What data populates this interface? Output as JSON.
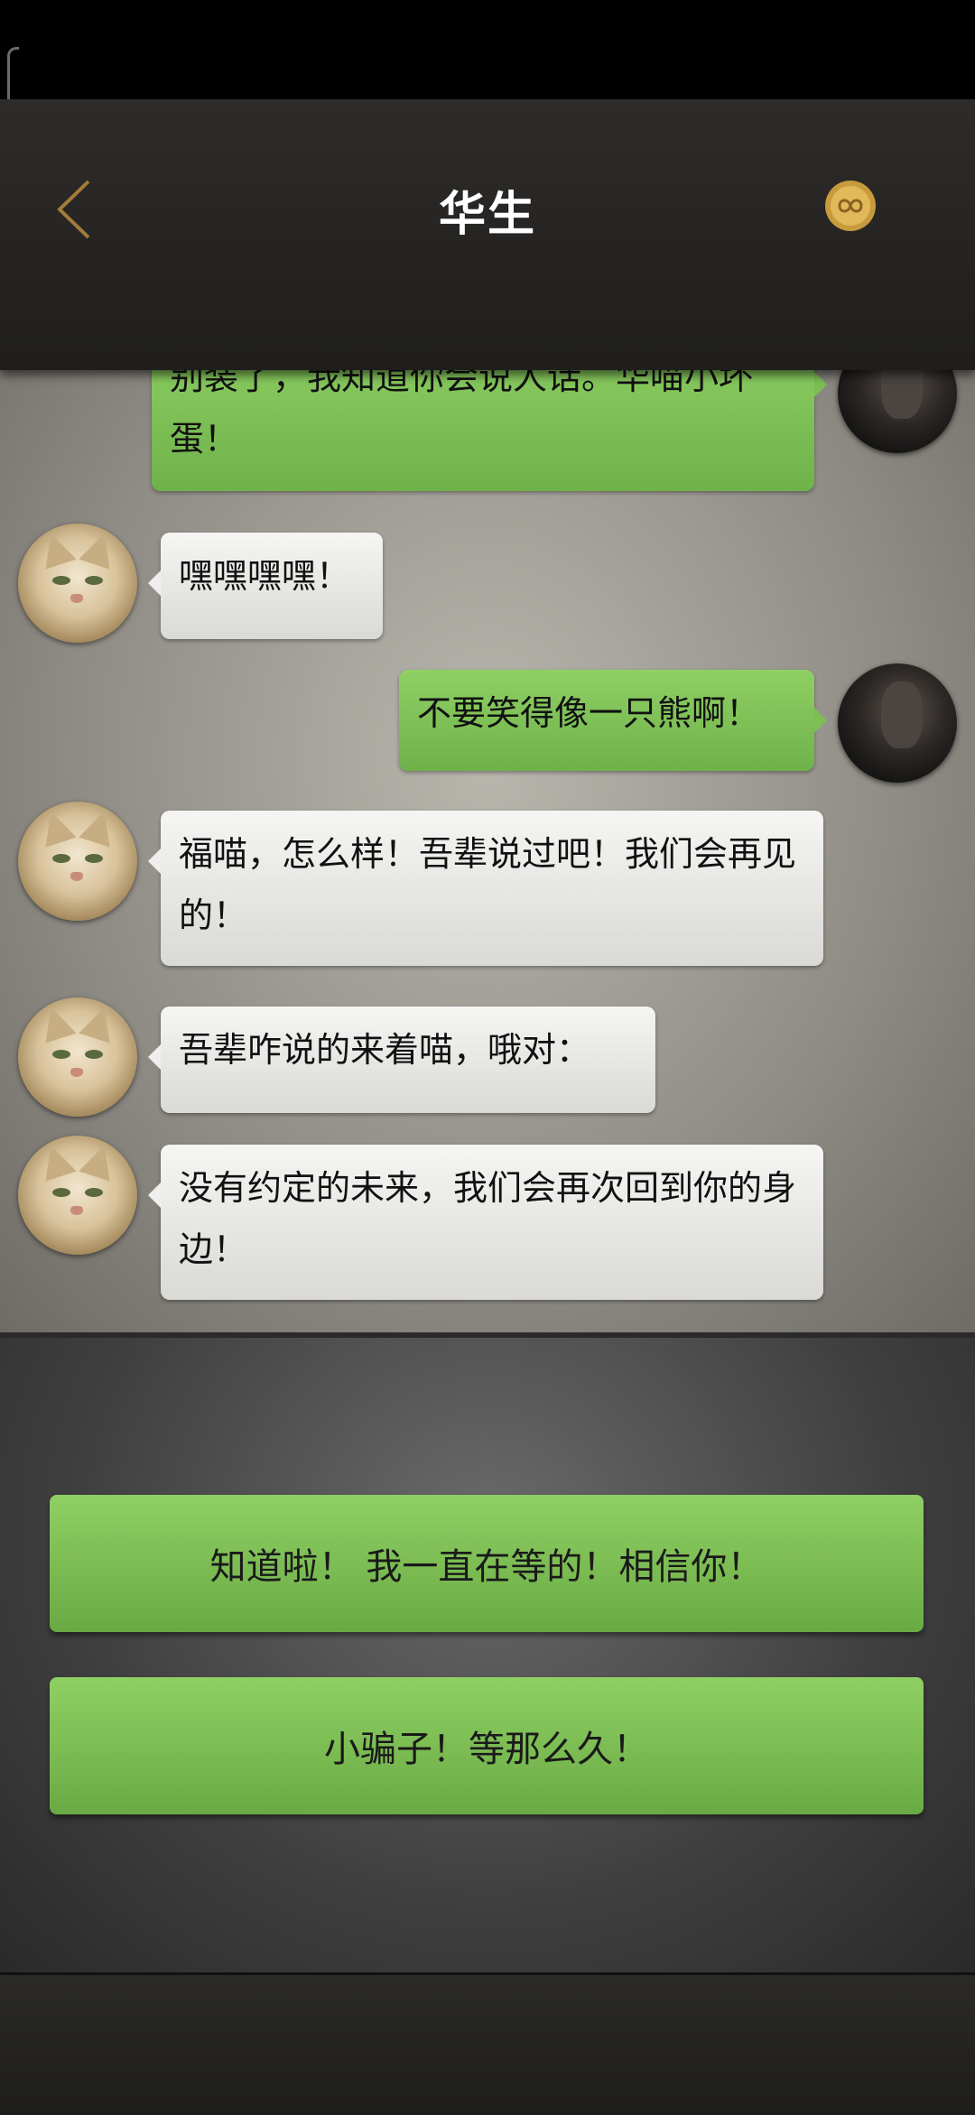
{
  "nav": {
    "title": "华生",
    "back_icon": "chevron-left-icon",
    "coin_icon": "infinity-coin-icon",
    "accent_color": "#a37b3a"
  },
  "messages": [
    {
      "side": "right",
      "sender": "user",
      "text": "别装了，我知道你会说人话。华喵小坏蛋！"
    },
    {
      "side": "left",
      "sender": "cat",
      "text": "嘿嘿嘿嘿！"
    },
    {
      "side": "right",
      "sender": "user",
      "text": "不要笑得像一只熊啊！"
    },
    {
      "side": "left",
      "sender": "cat",
      "text": "福喵，怎么样！吾辈说过吧！我们会再见的！"
    },
    {
      "side": "left",
      "sender": "cat",
      "text": "吾辈咋说的来着喵，哦对："
    },
    {
      "side": "left",
      "sender": "cat",
      "text": "没有约定的未来，我们会再次回到你的身边！"
    }
  ],
  "choices": [
    {
      "label": "知道啦！ 我一直在等的！相信你！"
    },
    {
      "label": "小骗子！等那么久！"
    }
  ]
}
